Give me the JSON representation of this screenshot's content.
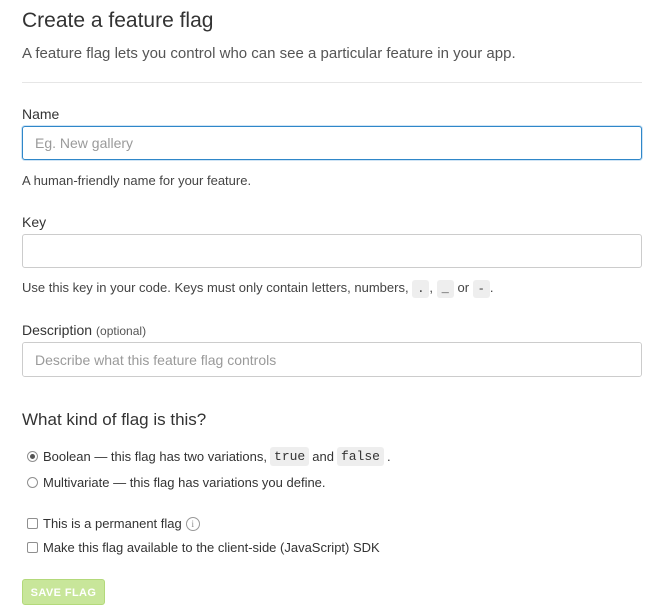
{
  "header": {
    "title": "Create a feature flag",
    "subtitle": "A feature flag lets you control who can see a particular feature in your app."
  },
  "name_field": {
    "label": "Name",
    "placeholder": "Eg. New gallery",
    "value": "",
    "help": "A human-friendly name for your feature."
  },
  "key_field": {
    "label": "Key",
    "value": "",
    "help_prefix": "Use this key in your code. Keys must only contain letters, numbers,",
    "chars": [
      ".",
      "_",
      "-"
    ],
    "sep_comma": ",",
    "sep_or": "or",
    "help_suffix": "."
  },
  "description_field": {
    "label": "Description",
    "optional": "(optional)",
    "placeholder": "Describe what this feature flag controls",
    "value": ""
  },
  "flag_kind": {
    "title": "What kind of flag is this?",
    "boolean": {
      "label_prefix": "Boolean — this flag has two variations,",
      "true_code": "true",
      "and_word": "and",
      "false_code": "false",
      "suffix": ".",
      "checked": true
    },
    "multivariate": {
      "label": "Multivariate — this flag has variations you define.",
      "checked": false
    }
  },
  "options": {
    "permanent_label": "This is a permanent flag",
    "permanent_info_glyph": "i",
    "client_side_label": "Make this flag available to the client-side (JavaScript) SDK"
  },
  "actions": {
    "save_label": "SAVE FLAG"
  },
  "colors": {
    "focus_border": "#2f87c9",
    "save_button_bg": "#c8e69a"
  }
}
